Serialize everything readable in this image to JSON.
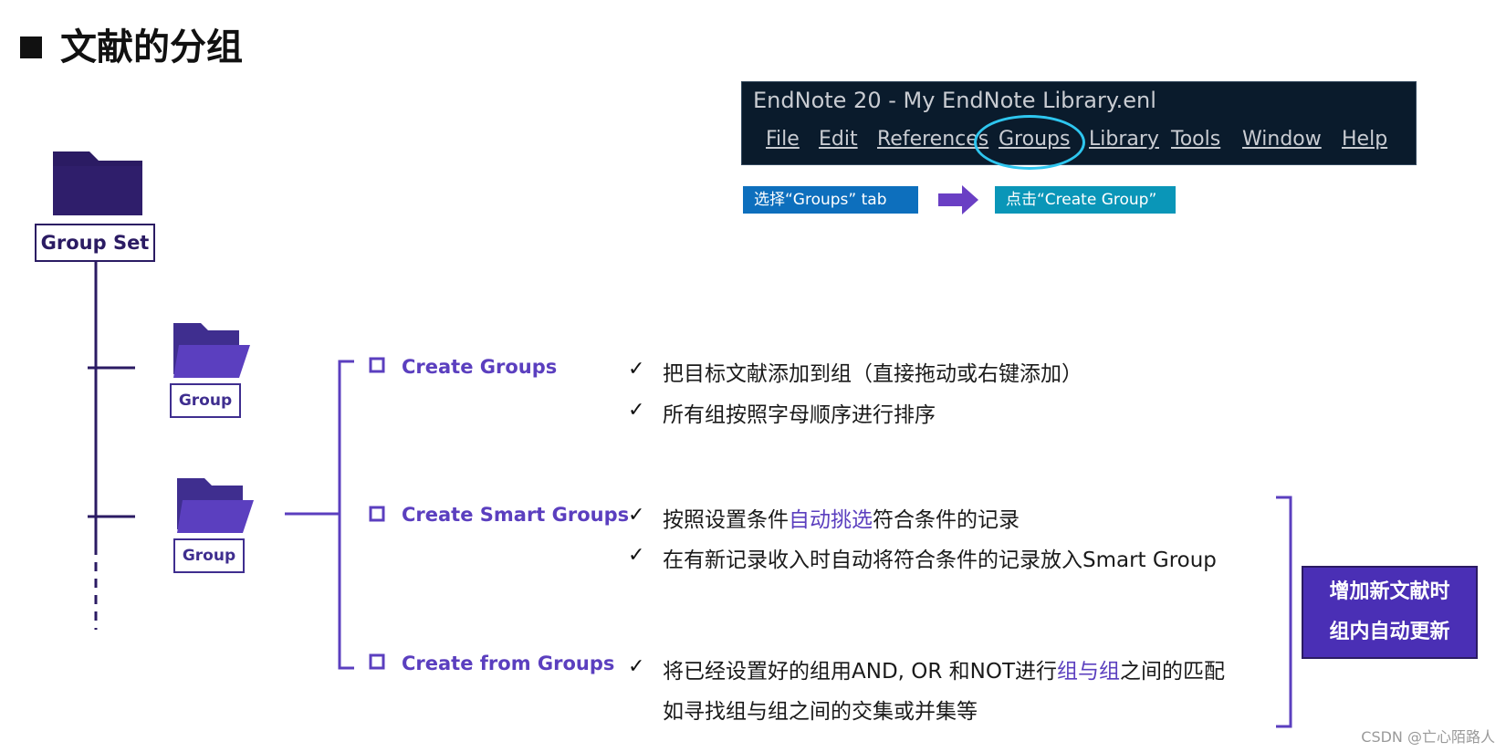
{
  "page": {
    "title": "文献的分组"
  },
  "endnote": {
    "window_title": "EndNote 20 - My EndNote Library.enl",
    "menu": [
      {
        "label": "File",
        "highlighted": false
      },
      {
        "label": "Edit",
        "highlighted": false
      },
      {
        "label": "References",
        "highlighted": false
      },
      {
        "label": "Groups",
        "highlighted": true
      },
      {
        "label": "Library",
        "highlighted": false
      },
      {
        "label": "Tools",
        "highlighted": false
      },
      {
        "label": "Window",
        "highlighted": false
      },
      {
        "label": "Help",
        "highlighted": false
      }
    ],
    "highlight_color": "#2ec6ef"
  },
  "steps": {
    "step1": "选择“Groups” tab",
    "step2": "点击“Create Group”"
  },
  "tree": {
    "root_label": "Group Set",
    "child_label_1": "Group",
    "child_label_2": "Group"
  },
  "options": {
    "create_groups": {
      "label": "Create Groups",
      "items": [
        "把目标文献添加到组（直接拖动或右键添加）",
        "所有组按照字母顺序进行排序"
      ]
    },
    "create_smart_groups": {
      "label": "Create Smart Groups",
      "item1_pre": "按照设置条件",
      "item1_hl": "自动挑选",
      "item1_post": "符合条件的记录",
      "item2": "在有新记录收入时自动将符合条件的记录放入Smart Group"
    },
    "create_from_groups": {
      "label": "Create from Groups",
      "item1_pre": "将已经设置好的组用AND, OR 和NOT进行",
      "item1_hl": "组与组",
      "item1_post": "之间的匹配",
      "item1_line2": "如寻找组与组之间的交集或并集等"
    }
  },
  "check_mark": "✓",
  "note": {
    "line1": "增加新文献时",
    "line2": "组内自动更新"
  },
  "watermark": "CSDN @亡心陌路人",
  "colors": {
    "accent": "#5b3fbf",
    "dark_purple": "#2b1b63",
    "step1": "#0d6fbd",
    "step2": "#0a96b8",
    "arrow": "#6a3fc4"
  }
}
